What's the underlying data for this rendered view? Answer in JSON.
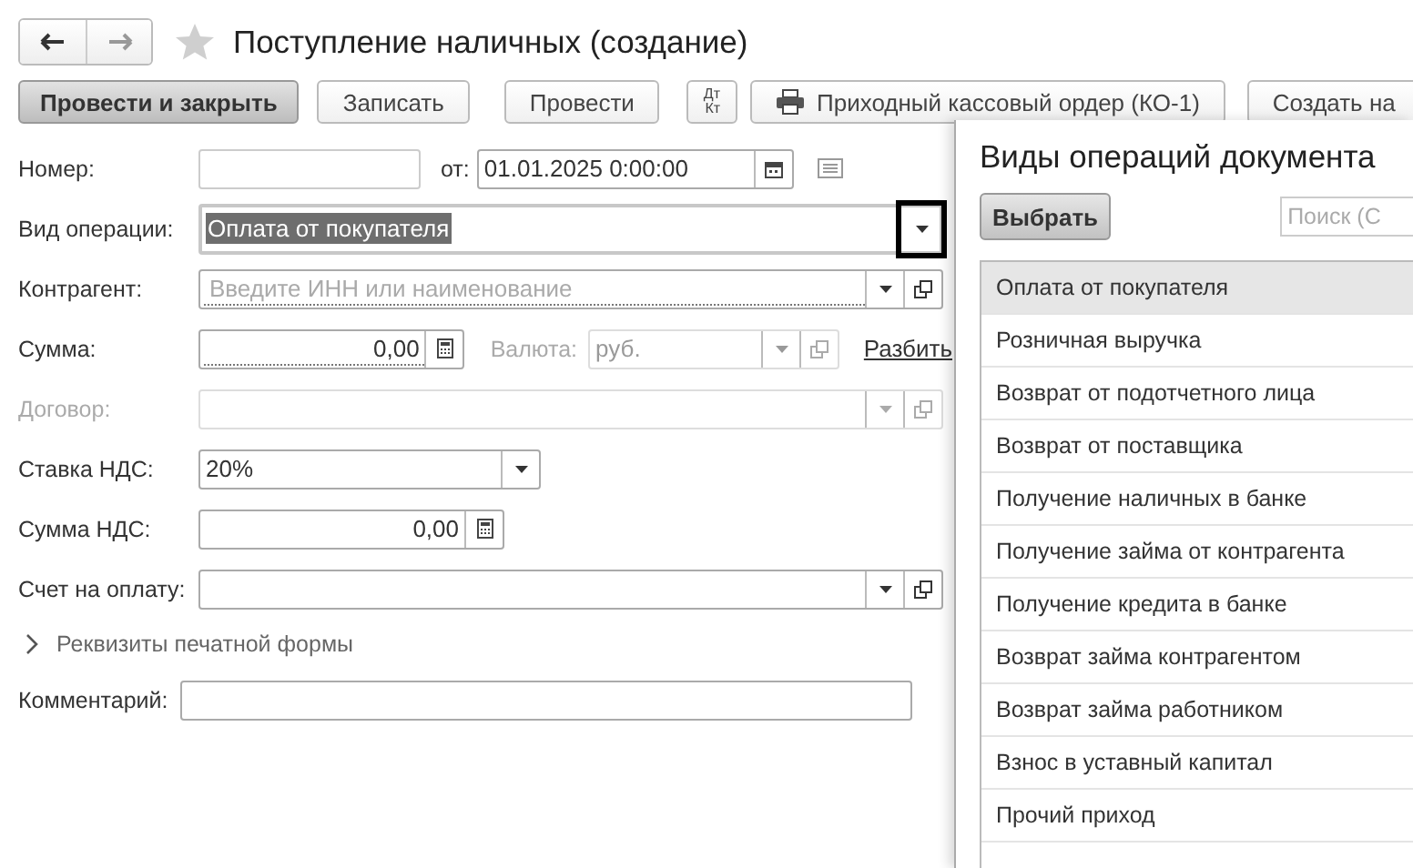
{
  "window": {
    "title": "Поступление наличных (создание)",
    "favorite": false
  },
  "toolbar": [
    {
      "label": "Провести и закрыть",
      "kind": "primary"
    },
    {
      "label": "Записать",
      "kind": "plain"
    },
    {
      "label": "Провести",
      "kind": "plain"
    },
    {
      "label": "Дт",
      "sub": "Кт",
      "kind": "dtkt"
    },
    {
      "label": "Приходный кассовый ордер (КО-1)",
      "kind": "print"
    },
    {
      "label": "Создать на",
      "kind": "plain"
    }
  ],
  "form": {
    "number": {
      "label": "Номер:",
      "date_label": "от:",
      "date": "01.01.2025  0:00:00"
    },
    "operation": {
      "label": "Вид операции:",
      "value": "Оплата от покупателя",
      "focused": true
    },
    "counterparty": {
      "label": "Контрагент:",
      "placeholder": "Введите ИНН или наименование",
      "disabled": false
    },
    "amount": {
      "label": "Сумма:",
      "value": "0,00",
      "currency_label": "Валюта:",
      "currency": "руб.",
      "currency_disabled": true,
      "link": "Разбить"
    },
    "contract": {
      "label": "Договор:",
      "disabled": true
    },
    "vat_rate": {
      "label": "Ставка НДС:",
      "value": "20%"
    },
    "vat_amount": {
      "label": "Сумма НДС:",
      "value": "0,00"
    },
    "invoice": {
      "label": "Счет на оплату:",
      "disabled": false
    },
    "print_details": {
      "label": "Реквизиты печатной формы",
      "expanded": false
    },
    "comment": {
      "label": "Комментарий:"
    }
  },
  "popup": {
    "title": "Виды операций документа",
    "select_button": "Выбрать",
    "search": {
      "placeholder": "Поиск (C"
    },
    "items": [
      {
        "label": "Оплата от покупателя",
        "selected": true
      },
      {
        "label": "Розничная выручка",
        "selected": false
      },
      {
        "label": "Возврат от подотчетного лица",
        "selected": false
      },
      {
        "label": "Возврат от поставщика",
        "selected": false
      },
      {
        "label": "Получение наличных в банке",
        "selected": false
      },
      {
        "label": "Получение займа от контрагента",
        "selected": false
      },
      {
        "label": "Получение кредита в банке",
        "selected": false
      },
      {
        "label": "Возврат займа контрагентом",
        "selected": false
      },
      {
        "label": "Возврат займа работником",
        "selected": false
      },
      {
        "label": "Взнос в уставный капитал",
        "selected": false
      },
      {
        "label": "Прочий приход",
        "selected": false
      }
    ]
  }
}
